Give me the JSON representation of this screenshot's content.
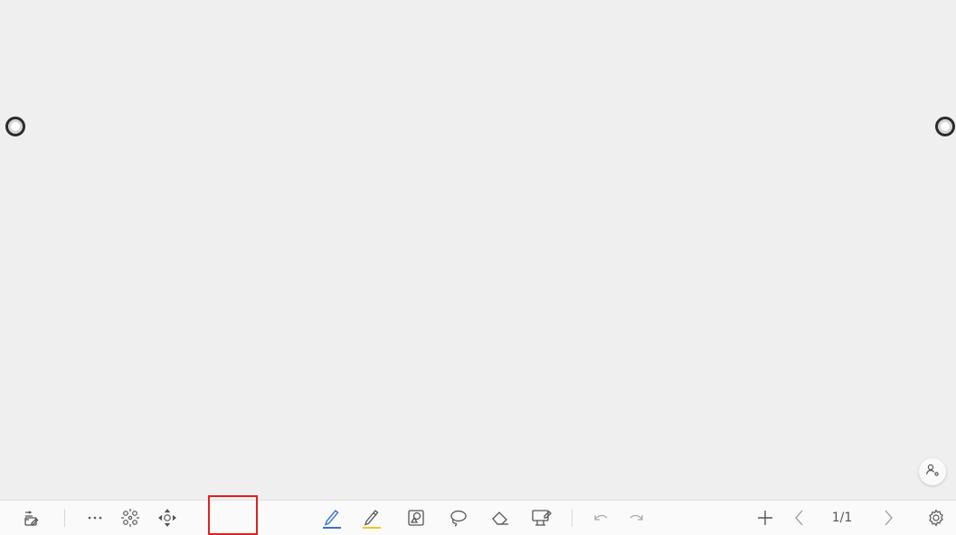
{
  "toolbar": {
    "page_indicator": "1/1"
  },
  "icons": {
    "menu": "menu-edit-icon",
    "more": "more-dots-icon",
    "grid": "grid-select-icon",
    "move": "move-icon",
    "pen": "pen-icon",
    "highlighter": "highlighter-icon",
    "shape": "shape-icon",
    "lasso": "lasso-icon",
    "eraser": "eraser-icon",
    "board": "board-icon",
    "undo": "undo-icon",
    "redo": "redo-icon",
    "add_page": "plus-icon",
    "prev_page": "chevron-left-icon",
    "next_page": "chevron-right-icon",
    "settings": "gear-icon",
    "user": "user-icon"
  },
  "colors": {
    "pen_active_underline": "#3b6fd8",
    "highlighter_underline": "#f3c623",
    "highlight_box": "#e02020",
    "canvas_bg": "#efefef"
  }
}
